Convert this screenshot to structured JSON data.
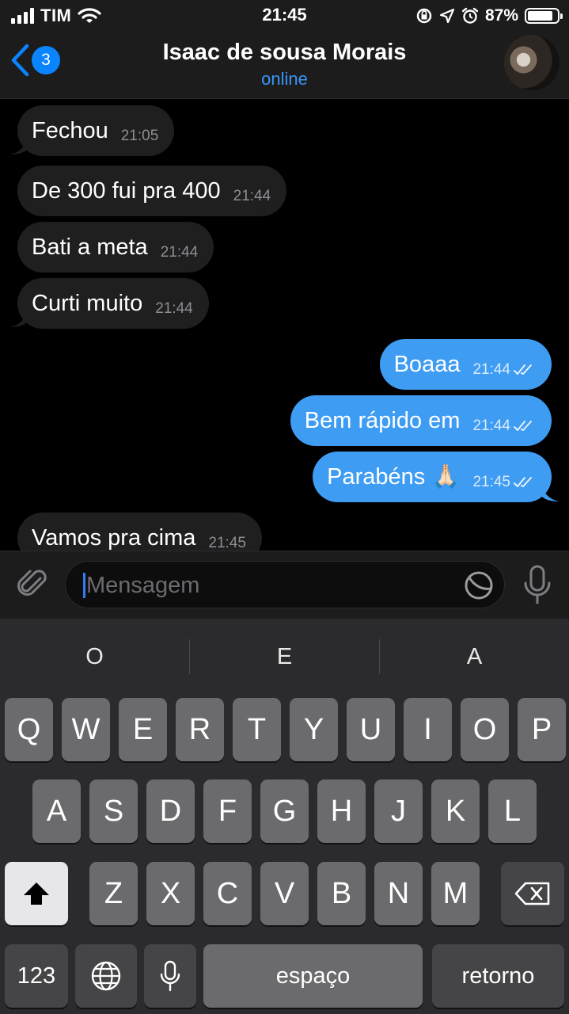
{
  "status_bar": {
    "carrier": "TIM",
    "time": "21:45",
    "battery": "87%",
    "battery_level": 0.87
  },
  "header": {
    "back_count": "3",
    "title": "Isaac de sousa Morais",
    "subtitle": "online"
  },
  "messages": [
    {
      "text": "Fechou",
      "time": "21:05",
      "direction": "incoming"
    },
    {
      "text": "De 300 fui pra 400",
      "time": "21:44",
      "direction": "incoming"
    },
    {
      "text": "Bati a meta",
      "time": "21:44",
      "direction": "incoming"
    },
    {
      "text": "Curti muito",
      "time": "21:44",
      "direction": "incoming"
    },
    {
      "text": "Boaaa",
      "time": "21:44",
      "direction": "outgoing",
      "read": true
    },
    {
      "text": "Bem rápido em",
      "time": "21:44",
      "direction": "outgoing",
      "read": true
    },
    {
      "text": "Parabéns 🙏🏻",
      "time": "21:45",
      "direction": "outgoing",
      "read": true
    },
    {
      "text": "Vamos pra cima",
      "time": "21:45",
      "direction": "incoming"
    }
  ],
  "composer": {
    "placeholder": "Mensagem"
  },
  "keyboard": {
    "suggestions": [
      "O",
      "E",
      "A"
    ],
    "row1": [
      "Q",
      "W",
      "E",
      "R",
      "T",
      "Y",
      "U",
      "I",
      "O",
      "P"
    ],
    "row2": [
      "A",
      "S",
      "D",
      "F",
      "G",
      "H",
      "J",
      "K",
      "L"
    ],
    "row3": [
      "Z",
      "X",
      "C",
      "V",
      "B",
      "N",
      "M"
    ],
    "numbers_label": "123",
    "space_label": "espaço",
    "return_label": "retorno"
  },
  "colors": {
    "accent": "#3e9cf3",
    "incoming_bubble": "#1f1f20",
    "badge": "#0a84ff"
  }
}
